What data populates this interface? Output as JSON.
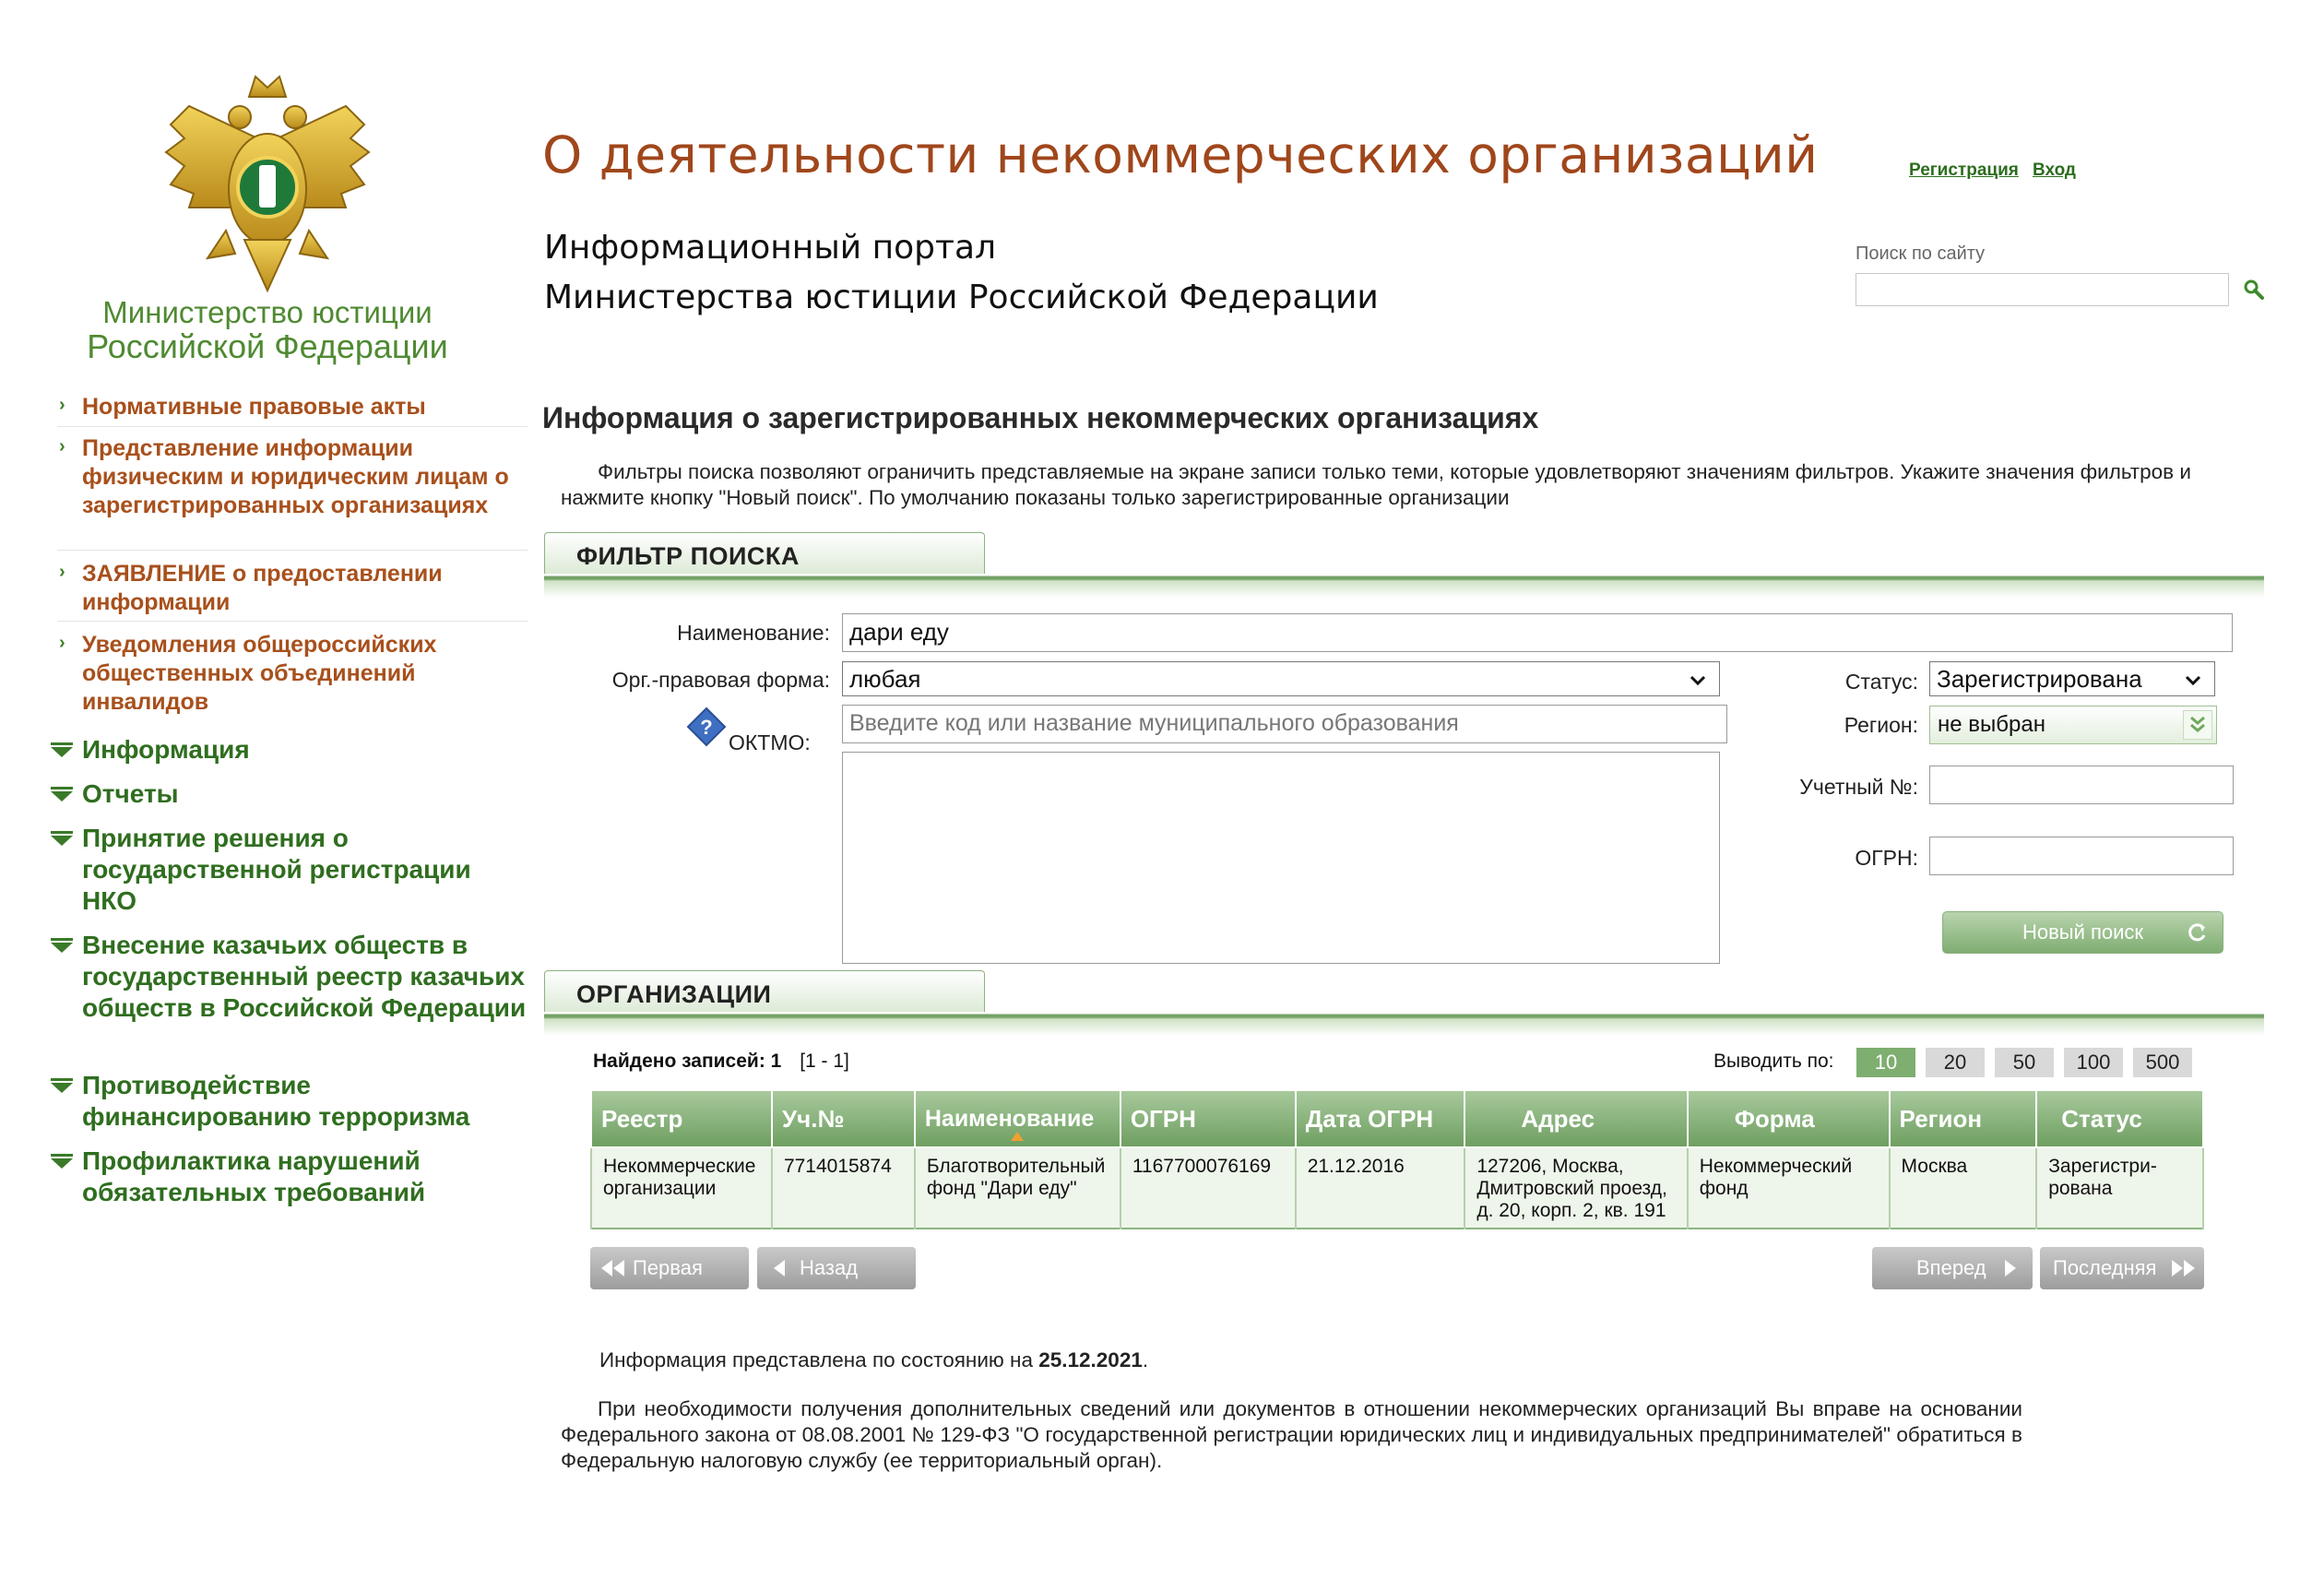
{
  "ministry": {
    "line1": "Министерство юстиции",
    "line2": "Российской Федерации"
  },
  "header": {
    "site_title": "О деятельности некоммерческих организаций",
    "portal_line1": "Информационный портал",
    "portal_line2": "Министерства юстиции Российской Федерации",
    "register_link": "Регистрация",
    "login_link": "Вход",
    "search_label": "Поиск по сайту",
    "search_value": ""
  },
  "sidebar": {
    "orange_items": [
      {
        "label": "Нормативные правовые акты"
      },
      {
        "label": "Представление информации физическим и юридическим лицам о зарегистрированных организациях"
      },
      {
        "label": "ЗАЯВЛЕНИЕ о предоставлении информации"
      },
      {
        "label": "Уведомления общероссийских общественных объединений инвалидов"
      }
    ],
    "green_items": [
      {
        "label": "Информация"
      },
      {
        "label": "Отчеты"
      },
      {
        "label": "Принятие решения о государственной регистрации НКО"
      },
      {
        "label": "Внесение казачьих обществ в государственный реестр казачьих обществ в Российской Федерации"
      },
      {
        "label": "Противодействие финансированию терроризма"
      },
      {
        "label": "Профилактика нарушений обязательных требований"
      }
    ]
  },
  "main": {
    "section_title": "Информация о зарегистрированных некоммерческих организациях",
    "intro": "Фильтры поиска позволяют ограничить представляемые на экране записи только теми, которые удовлетворяют значениям фильтров. Укажите значения фильтров и нажмите кнопку \"Новый поиск\". По умолчанию показаны только зарегистрированные организации",
    "filter_tab": "ФИЛЬТР ПОИСКА",
    "orgs_tab": "ОРГАНИЗАЦИИ"
  },
  "filter": {
    "name_label": "Наименование:",
    "name_value": "дари еду",
    "form_label": "Орг.-правовая форма:",
    "form_value": "любая",
    "oktmo_label": "ОКТМО:",
    "oktmo_placeholder": "Введите код или название муниципального образования",
    "status_label": "Статус:",
    "status_value": "Зарегистрирована",
    "region_label": "Регион:",
    "region_value": "не выбран",
    "reg_num_label": "Учетный №:",
    "reg_num_value": "",
    "ogrn_label": "ОГРН:",
    "ogrn_value": "",
    "search_button": "Новый поиск"
  },
  "results": {
    "found_label": "Найдено записей:",
    "found_count": "1",
    "range": "[1 - 1]",
    "per_page_label": "Выводить по:",
    "per_page_options": [
      "10",
      "20",
      "50",
      "100",
      "500"
    ],
    "per_page_selected": "10",
    "columns": [
      "Реестр",
      "Уч.№",
      "Наименование",
      "ОГРН",
      "Дата ОГРН",
      "Адрес",
      "Форма",
      "Регион",
      "Статус"
    ],
    "rows": [
      {
        "registry": "Некоммерческие организации",
        "reg_num": "7714015874",
        "name": "Благотворительный фонд \"Дари еду\"",
        "ogrn": "1167700076169",
        "ogrn_date": "21.12.2016",
        "address": "127206, Москва, Дмитровский проезд, д. 20, корп. 2, кв. 191",
        "form": "Некоммерческий фонд",
        "region": "Москва",
        "status": "Зарегистри-рована"
      }
    ],
    "nav": {
      "first": "Первая",
      "prev": "Назад",
      "next": "Вперед",
      "last": "Последняя"
    }
  },
  "footer": {
    "state_prefix": "Информация представлена по состоянию на",
    "state_date": "25.12.2021",
    "state_suffix": ".",
    "note": "При необходимости получения дополнительных сведений или документов в отношении некоммерческих организаций Вы вправе на основании Федерального закона от 08.08.2001 № 129-ФЗ \"О государственной регистрации юридических лиц и индивидуальных предпринимателей\" обратиться в Федеральную налоговую службу (ее территориальный орган)."
  },
  "colors": {
    "brand_green": "#2f6e1f",
    "accent_orange": "#a0461b",
    "table_header": "#7eae70"
  }
}
